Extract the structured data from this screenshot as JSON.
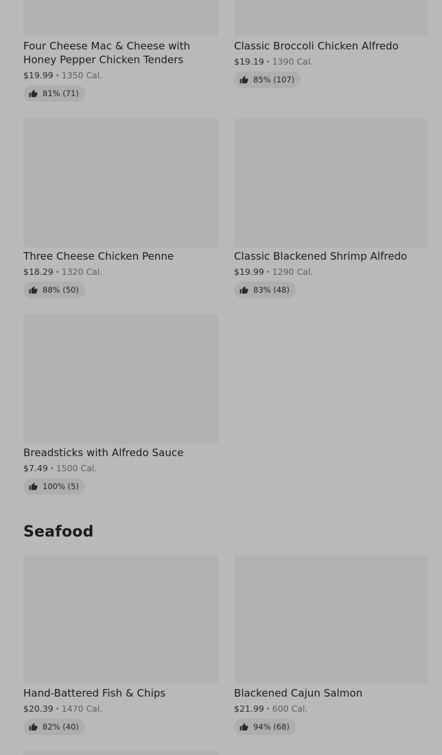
{
  "colors": {
    "page_background": "#b9b9b9",
    "thumbnail": "#b2b2b2",
    "rating_pill": "#aeaeae"
  },
  "items": [
    {
      "name": "Four Cheese Mac & Cheese with Honey Pepper Chicken Tenders",
      "price": "$19.99",
      "calories": "1350 Cal.",
      "rating": "81% (71)",
      "icon": "thumbs-up-icon"
    },
    {
      "name": "Classic Broccoli Chicken Alfredo",
      "price": "$19.19",
      "calories": "1390 Cal.",
      "rating": "85% (107)",
      "icon": "thumbs-up-icon"
    },
    {
      "name": "Three Cheese Chicken Penne",
      "price": "$18.29",
      "calories": "1320 Cal.",
      "rating": "88% (50)",
      "icon": "thumbs-up-icon"
    },
    {
      "name": "Classic Blackened Shrimp Alfredo",
      "price": "$19.99",
      "calories": "1290 Cal.",
      "rating": "83% (48)",
      "icon": "thumbs-up-icon"
    },
    {
      "name": "Breadsticks with Alfredo Sauce",
      "price": "$7.49",
      "calories": "1500 Cal.",
      "rating": "100% (5)",
      "icon": "thumbs-up-icon"
    }
  ],
  "seafood": {
    "title": "Seafood",
    "items": [
      {
        "name": "Hand-Battered Fish & Chips",
        "price": "$20.39",
        "calories": "1470 Cal.",
        "rating": "82% (40)",
        "icon": "thumbs-up-icon"
      },
      {
        "name": "Blackened Cajun Salmon",
        "price": "$21.99",
        "calories": "600 Cal.",
        "rating": "94% (68)",
        "icon": "thumbs-up-icon"
      }
    ]
  },
  "separator": "•"
}
